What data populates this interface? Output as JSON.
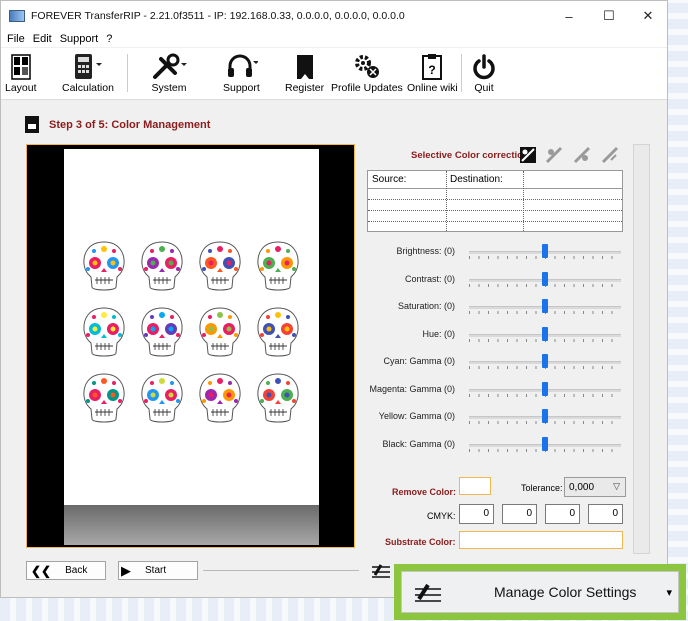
{
  "window": {
    "title": "FOREVER TransferRIP - 2.21.0f3511 - IP: 192.168.0.33, 0.0.0.0, 0.0.0.0, 0.0.0.0",
    "controls": [
      "–",
      "☐",
      "✕"
    ]
  },
  "menu": [
    "File",
    "Edit",
    "Support",
    "?"
  ],
  "toolbar": {
    "layout": "Layout",
    "calculation": "Calculation",
    "system": "System",
    "support": "Support",
    "register": "Register",
    "profile_updates": "Profile Updates",
    "online_wiki": "Online wiki",
    "quit": "Quit"
  },
  "step": {
    "title": "Step 3 of 5: Color Management"
  },
  "selective": {
    "title": "Selective Color correction:",
    "table_headers": [
      "Source:",
      "Destination:"
    ]
  },
  "sliders": [
    {
      "label": "Brightness: (0)",
      "value": 0
    },
    {
      "label": "Contrast:  (0)",
      "value": 0
    },
    {
      "label": "Saturation: (0)",
      "value": 0
    },
    {
      "label": "Hue: (0)",
      "value": 0
    },
    {
      "label": "Cyan: Gamma (0)",
      "value": 0
    },
    {
      "label": "Magenta: Gamma (0)",
      "value": 0
    },
    {
      "label": "Yellow: Gamma (0)",
      "value": 0
    },
    {
      "label": "Black: Gamma (0)",
      "value": 0
    }
  ],
  "remove_color": {
    "label": "Remove Color:"
  },
  "tolerance": {
    "label": "Tolerance:",
    "value": "0,000"
  },
  "cmyk": {
    "label": "CMYK:",
    "values": [
      "0",
      "0",
      "0",
      "0"
    ]
  },
  "substrate": {
    "label": "Substrate Color:"
  },
  "nav": {
    "back": "Back",
    "start": "Start"
  },
  "manage": {
    "label": "Manage Color Settings",
    "arrow": "▾"
  },
  "colors": {
    "accent_red": "#8a1c1c",
    "highlight_orange": "#f1b64d",
    "zoom_green": "#8cc63f",
    "slider_blue": "#1a73e8"
  }
}
